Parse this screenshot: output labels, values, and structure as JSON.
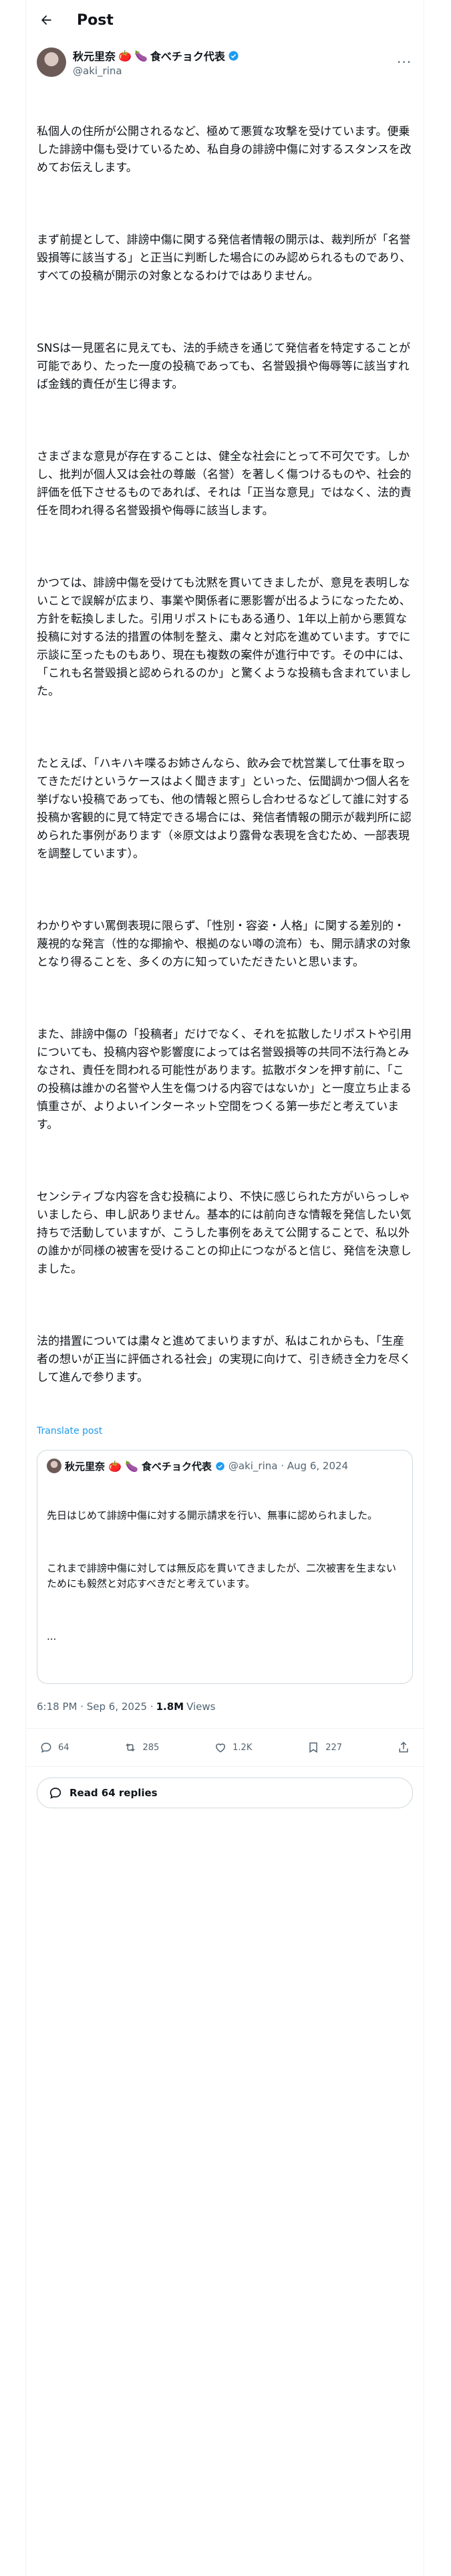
{
  "header": {
    "title": "Post"
  },
  "author": {
    "name": "秋元里奈",
    "name_suffix": "食べチョク代表",
    "handle": "@aki_rina",
    "emojis": [
      "🍅",
      "🍆"
    ]
  },
  "post": {
    "paragraphs": [
      "私個人の住所が公開されるなど、極めて悪質な攻撃を受けています。便乗した誹謗中傷も受けているため、私自身の誹謗中傷に対するスタンスを改めてお伝えします。",
      "まず前提として、誹謗中傷に関する発信者情報の開示は、裁判所が「名誉毀損等に該当する」と正当に判断した場合にのみ認められるものであり、すべての投稿が開示の対象となるわけではありません。",
      "SNSは一見匿名に見えても、法的手続きを通じて発信者を特定することが可能であり、たった一度の投稿であっても、名誉毀損や侮辱等に該当すれば金銭的責任が生じ得ます。",
      "さまざまな意見が存在することは、健全な社会にとって不可欠です。しかし、批判が個人又は会社の尊厳（名誉）を著しく傷つけるものや、社会的評価を低下させるものであれば、それは「正当な意見」ではなく、法的責任を問われ得る名誉毀損や侮辱に該当します。",
      "かつては、誹謗中傷を受けても沈黙を貫いてきましたが、意見を表明しないことで誤解が広まり、事業や関係者に悪影響が出るようになったため、方針を転換しました。引用リポストにもある通り、1年以上前から悪質な投稿に対する法的措置の体制を整え、粛々と対応を進めています。すでに示談に至ったものもあり、現在も複数の案件が進行中です。その中には、「これも名誉毀損と認められるのか」と驚くような投稿も含まれていました。",
      "たとえば、「ハキハキ喋るお姉さんなら、飲み会で枕営業して仕事を取ってきただけというケースはよく聞きます」といった、伝聞調かつ個人名を挙げない投稿であっても、他の情報と照らし合わせるなどして誰に対する投稿か客観的に見て特定できる場合には、発信者情報の開示が裁判所に認められた事例があります（※原文はより露骨な表現を含むため、一部表現を調整しています）。",
      "わかりやすい罵倒表現に限らず、「性別・容姿・人格」に関する差別的・蔑視的な発言（性的な揶揄や、根拠のない噂の流布）も、開示請求の対象となり得ることを、多くの方に知っていただきたいと思います。",
      "また、誹謗中傷の「投稿者」だけでなく、それを拡散したリポストや引用についても、投稿内容や影響度によっては名誉毀損等の共同不法行為とみなされ、責任を問われる可能性があります。拡散ボタンを押す前に、「この投稿は誰かの名誉や人生を傷つける内容ではないか」と一度立ち止まる慎重さが、よりよいインターネット空間をつくる第一歩だと考えています。",
      "センシティブな内容を含む投稿により、不快に感じられた方がいらっしゃいましたら、申し訳ありません。基本的には前向きな情報を発信したい気持ちで活動していますが、こうした事例をあえて公開することで、私以外の誰かが同様の被害を受けることの抑止につながると信じ、発信を決意しました。",
      "法的措置については粛々と進めてまいりますが、私はこれからも、「生産者の想いが正当に評価される社会」の実現に向けて、引き続き全力を尽くして進んで参ります。"
    ],
    "translate_label": "Translate post"
  },
  "quote": {
    "name": "秋元里奈",
    "name_suffix": "食べチョク代表",
    "handle_date": "@aki_rina · Aug 6, 2024",
    "paragraphs": [
      "先日はじめて誹謗中傷に対する開示請求を行い、無事に認められました。",
      "これまで誹謗中傷に対しては無反応を貫いてきましたが、二次被害を生まないためにも毅然と対応すべきだと考えています。",
      "..."
    ]
  },
  "meta": {
    "time": "6:18 PM · Sep 6, 2025 ·",
    "views_count": "1.8M",
    "views_label": "Views"
  },
  "actions": {
    "replies": "64",
    "reposts": "285",
    "likes": "1.2K",
    "bookmarks": "227"
  },
  "read_replies": "Read 64 replies",
  "colors": {
    "accent": "#1d9bf0",
    "muted": "#536471",
    "border": "#cfd9de"
  }
}
